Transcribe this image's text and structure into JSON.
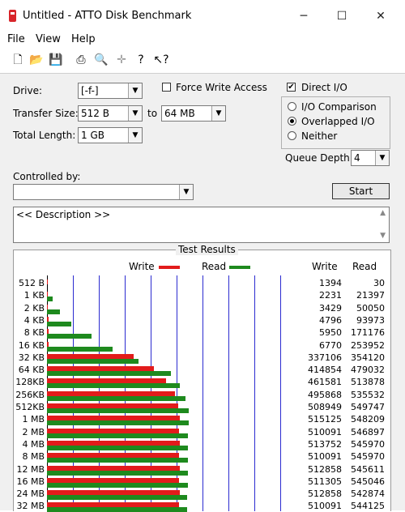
{
  "window": {
    "title": "Untitled - ATTO Disk Benchmark"
  },
  "menu": [
    "File",
    "View",
    "Help"
  ],
  "toolbar_icons": [
    "new-file-icon",
    "open-folder-icon",
    "save-icon",
    "print-icon",
    "print-preview-icon",
    "move-icon",
    "help-icon",
    "context-help-icon"
  ],
  "form": {
    "drive_label": "Drive:",
    "drive_value": "[-f-]",
    "transfer_size_label": "Transfer Size:",
    "transfer_from": "512 B",
    "to_label": "to",
    "transfer_to": "64 MB",
    "total_length_label": "Total Length:",
    "total_length_value": "1 GB",
    "force_write_label": "Force Write Access",
    "force_write_checked": false,
    "direct_io_label": "Direct I/O",
    "direct_io_checked": true,
    "io_comparison_label": "I/O Comparison",
    "overlapped_io_label": "Overlapped I/O",
    "neither_label": "Neither",
    "selected_mode": "Overlapped I/O",
    "queue_depth_label": "Queue Depth:",
    "queue_depth_value": "4",
    "controlled_by_label": "Controlled by:",
    "controlled_by_value": "",
    "start_label": "Start",
    "description_text": "<< Description >>"
  },
  "results": {
    "title": "Test Results",
    "legend_write": "Write",
    "legend_read": "Read",
    "col_write": "Write",
    "col_read": "Read",
    "write_color": "#e21b1b",
    "read_color": "#1e8a1e"
  },
  "chart_data": {
    "type": "bar",
    "x_max": 560000,
    "categories": [
      "512 B",
      "1 KB",
      "2 KB",
      "4 KB",
      "8 KB",
      "16 KB",
      "32 KB",
      "64 KB",
      "128KB",
      "256KB",
      "512KB",
      "1 MB",
      "2 MB",
      "4 MB",
      "8 MB",
      "12 MB",
      "16 MB",
      "24 MB",
      "32 MB"
    ],
    "series": [
      {
        "name": "Write",
        "values": [
          1394,
          2231,
          3429,
          4796,
          5950,
          6770,
          337106,
          414854,
          461581,
          495868,
          508949,
          515125,
          510091,
          513752,
          510091,
          512858,
          511305,
          512858,
          510091
        ]
      },
      {
        "name": "Read",
        "values": [
          30,
          21397,
          50050,
          93973,
          171176,
          253952,
          354120,
          479032,
          513878,
          535532,
          549747,
          548209,
          546897,
          545970,
          545970,
          545611,
          545046,
          542874,
          544125
        ]
      }
    ]
  }
}
